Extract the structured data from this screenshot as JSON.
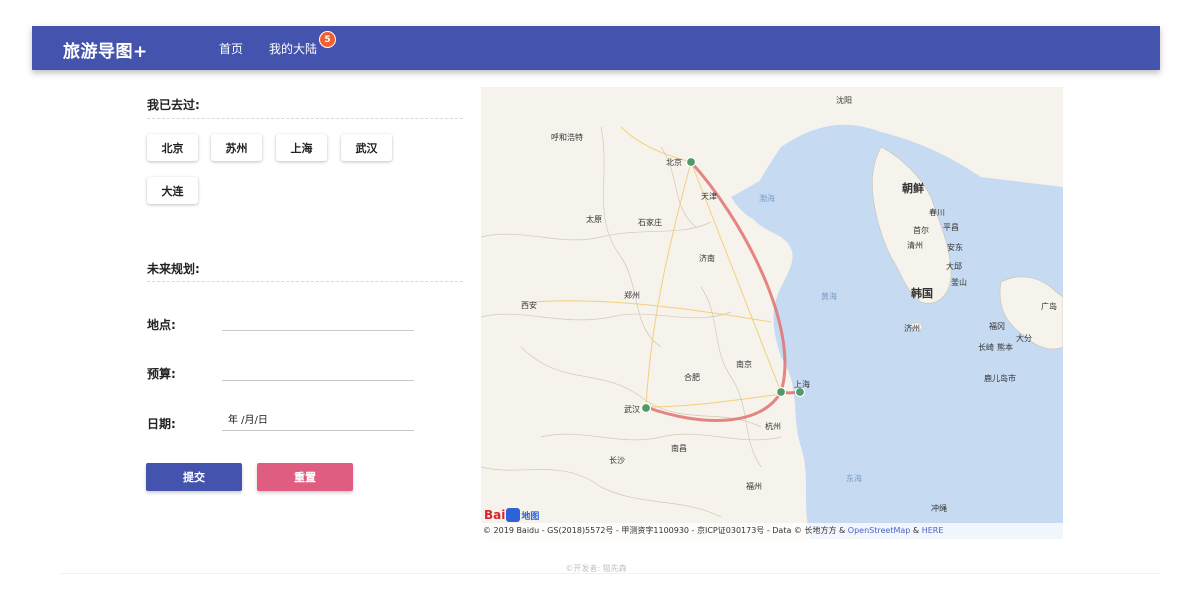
{
  "header": {
    "brand": "旅游导图+",
    "nav": [
      {
        "label": "首页"
      },
      {
        "label": "我的大陆"
      }
    ],
    "badge_count": "5",
    "bg_color": "#4453ad",
    "badge_color": "#f06033"
  },
  "visited": {
    "title": "我已去过:",
    "cities": [
      "北京",
      "苏州",
      "上海",
      "武汉",
      "大连"
    ]
  },
  "plan": {
    "title": "未来规划:",
    "fields": {
      "location_label": "地点:",
      "location_value": "",
      "budget_label": "预算:",
      "budget_value": "",
      "date_label": "日期:",
      "date_value": "年 /月/日"
    },
    "submit_label": "提交",
    "reset_label": "重置",
    "submit_color": "#4453ad",
    "reset_color": "#df5d80"
  },
  "map": {
    "labels": {
      "shenyang": "沈阳",
      "hohhot": "呼和浩特",
      "beijing": "北京",
      "tianjin": "天津",
      "bohai": "渤海",
      "taiyuan": "太原",
      "shijiazhuang": "石家庄",
      "jinan": "济南",
      "xian": "西安",
      "zhengzhou": "郑州",
      "yellowsea": "黄海",
      "hefei": "合肥",
      "nanjing": "南京",
      "shanghai": "上海",
      "wuhan": "武汉",
      "hangzhou": "杭州",
      "nanchang": "南昌",
      "changsha": "长沙",
      "fuzhou": "福州",
      "eastsea": "东海",
      "korea_north": "朝鲜",
      "korea_south": "韩国",
      "chuncheon": "春川",
      "seoul": "首尔",
      "pyeongchang": "平昌",
      "cheongju": "清州",
      "andong": "安东",
      "daegu": "大邱",
      "busan": "釜山",
      "jeju": "济州",
      "fukuoka": "福冈",
      "nagasaki": "长崎",
      "kumamoto": "熊本",
      "oita": "大分",
      "hiroshima": "广岛",
      "kagoshima": "鹿儿岛市",
      "okinawa": "冲绳"
    },
    "logo_text": "Bai",
    "logo_suffix": "地图",
    "copyright_prefix": "© 2019 Baidu - GS(2018)5572号 - 甲测资字1100930 - 京ICP证030173号 - Data © 长地方方 & ",
    "copyright_osm": "OpenStreetMap",
    "copyright_amp": " & ",
    "copyright_here": "HERE",
    "route_color": "#e0716e",
    "marker_color": "#4f9a6a"
  },
  "footer": {
    "text": "©开发者: 猫先森"
  }
}
